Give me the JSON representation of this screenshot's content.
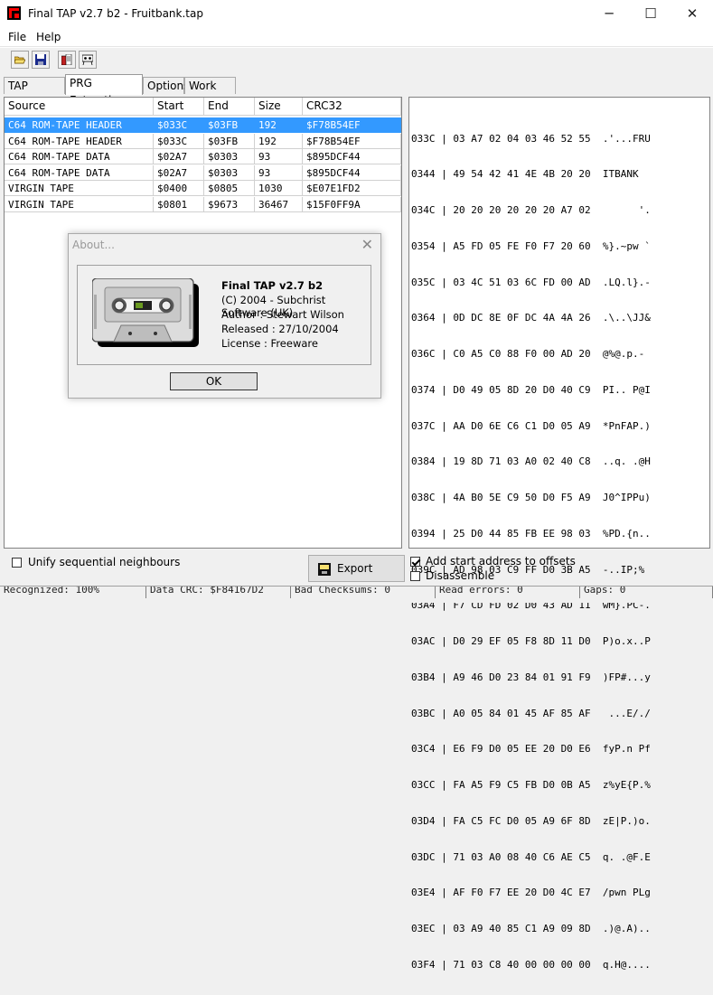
{
  "window": {
    "title": "Final TAP v2.7 b2 - Fruitbank.tap",
    "minimize_glyph": "─",
    "maximize_glyph": "☐",
    "close_glyph": "✕"
  },
  "menu": [
    "File",
    "Help"
  ],
  "toolbar": {
    "icons": [
      "open-folder-icon",
      "save-disk-icon",
      "export-icon",
      "tape-icon"
    ]
  },
  "tabs": [
    {
      "label": "TAP Report",
      "active": false
    },
    {
      "label": "PRG Extraction",
      "active": true
    },
    {
      "label": "Options",
      "active": false
    },
    {
      "label": "Work Log",
      "active": false
    }
  ],
  "table": {
    "columns": [
      "Source",
      "Start",
      "End",
      "Size",
      "CRC32"
    ],
    "rows": [
      [
        "C64 ROM-TAPE HEADER",
        "$033C",
        "$03FB",
        "192",
        "$F78B54EF"
      ],
      [
        "C64 ROM-TAPE HEADER",
        "$033C",
        "$03FB",
        "192",
        "$F78B54EF"
      ],
      [
        "C64 ROM-TAPE DATA",
        "$02A7",
        "$0303",
        "93",
        "$895DCF44"
      ],
      [
        "C64 ROM-TAPE DATA",
        "$02A7",
        "$0303",
        "93",
        "$895DCF44"
      ],
      [
        "VIRGIN TAPE",
        "$0400",
        "$0805",
        "1030",
        "$E07E1FD2"
      ],
      [
        "VIRGIN TAPE",
        "$0801",
        "$9673",
        "36467",
        "$15F0FF9A"
      ]
    ],
    "selected_row": 0
  },
  "hexdump": [
    "033C | 03 A7 02 04 03 46 52 55  .'...FRU",
    "0344 | 49 54 42 41 4E 4B 20 20  ITBANK  ",
    "034C | 20 20 20 20 20 20 A7 02        '.",
    "0354 | A5 FD 05 FE F0 F7 20 60  %}.~pw `",
    "035C | 03 4C 51 03 6C FD 00 AD  .LQ.l}.-",
    "0364 | 0D DC 8E 0F DC 4A 4A 26  .\\..\\JJ&",
    "036C | C0 A5 C0 88 F0 00 AD 20  @%@.p.- ",
    "0374 | D0 49 05 8D 20 D0 40 C9  PI.. P@I",
    "037C | AA D0 6E C6 C1 D0 05 A9  *PnFAP.)",
    "0384 | 19 8D 71 03 A0 02 40 C8  ..q. .@H",
    "038C | 4A B0 5E C9 50 D0 F5 A9  J0^IPPu)",
    "0394 | 25 D0 44 85 FB EE 98 03  %PD.{n..",
    "039C | AD 98 03 C9 FF D0 3B A5  -..IP;%",
    "03A4 | F7 CD FD 02 D0 43 AD 11  wM}.PC-.",
    "03AC | D0 29 EF 05 F8 8D 11 D0  P)o.x..P",
    "03B4 | A9 46 D0 23 84 01 91 F9  )FP#...y",
    "03BC | A0 05 84 01 45 AF 85 AF   ...E/./",
    "03C4 | E6 F9 D0 05 EE 20 D0 E6  fyP.n Pf",
    "03CC | FA A5 F9 C5 FB D0 0B A5  z%yE{P.%",
    "03D4 | FA C5 FC D0 05 A9 6F 8D  zE|P.)o.",
    "03DC | 71 03 A0 08 40 C6 AE C5  q. .@F.E",
    "03E4 | AF F0 F7 EE 20 D0 4C E7  /pwn PLg",
    "03EC | 03 A9 40 85 C1 A9 09 8D  .)@.A)..",
    "03F4 | 71 03 C8 40 00 00 00 00  q.H@...."
  ],
  "options": {
    "unify_label": "Unify sequential neighbours",
    "unify_checked": false,
    "export_label": "Export PRG...",
    "add_start_label": "Add start address to offsets",
    "add_start_checked": true,
    "disassemble_label": "Disassemble",
    "disassemble_checked": false
  },
  "status": {
    "recognized": "Recognized: 100%",
    "data_crc": "Data CRC: $F84167D2",
    "bad_checksums": "Bad Checksums: 0",
    "read_errors": "Read errors: 0",
    "gaps": "Gaps: 0"
  },
  "about": {
    "title": "About...",
    "close_glyph": "✕",
    "product": "Final TAP v2.7 b2",
    "copyright": "(C) 2004 - Subchrist Software (UK)",
    "author": "Author : Stewart Wilson",
    "released": "Released : 27/10/2004",
    "license": "License : Freeware",
    "ok_label": "OK"
  }
}
